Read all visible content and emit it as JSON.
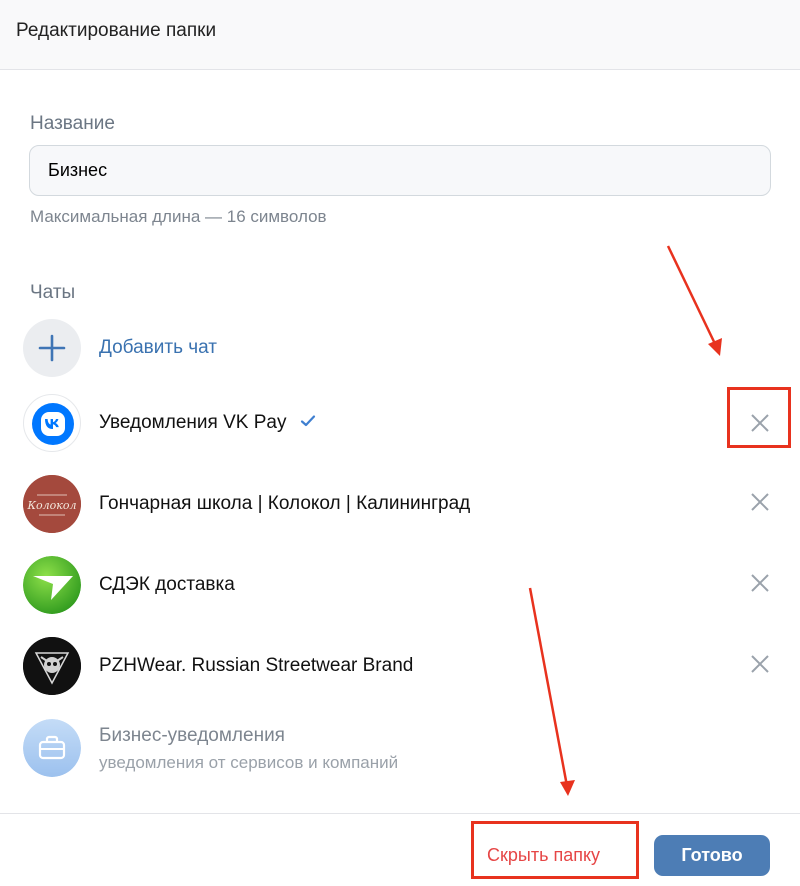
{
  "header": {
    "title": "Редактирование папки"
  },
  "form": {
    "name_label": "Название",
    "name_value": "Бизнес",
    "hint": "Максимальная длина — 16 символов",
    "chats_label": "Чаты"
  },
  "add_chat": {
    "label": "Добавить чат"
  },
  "chats": [
    {
      "title": "Уведомления VK Pay",
      "verified": true
    },
    {
      "title": "Гончарная школа | Колокол | Калининград"
    },
    {
      "title": "СДЭК доставка"
    },
    {
      "title": "PZHWear. Russian Streetwear Brand"
    }
  ],
  "business": {
    "title": "Бизнес-уведомления",
    "subtitle": "уведомления от сервисов и компаний"
  },
  "avatar_text": {
    "kolokol": "Колокол"
  },
  "footer": {
    "hide_label": "Скрыть папку",
    "done_label": "Готово"
  },
  "colors": {
    "accent": "#4d7db5",
    "danger": "#e64646",
    "annotation": "#e8321e"
  },
  "icons": [
    "plus-icon",
    "vk-logo-icon",
    "verified-icon",
    "close-icon",
    "briefcase-icon",
    "arrow-annotation"
  ]
}
